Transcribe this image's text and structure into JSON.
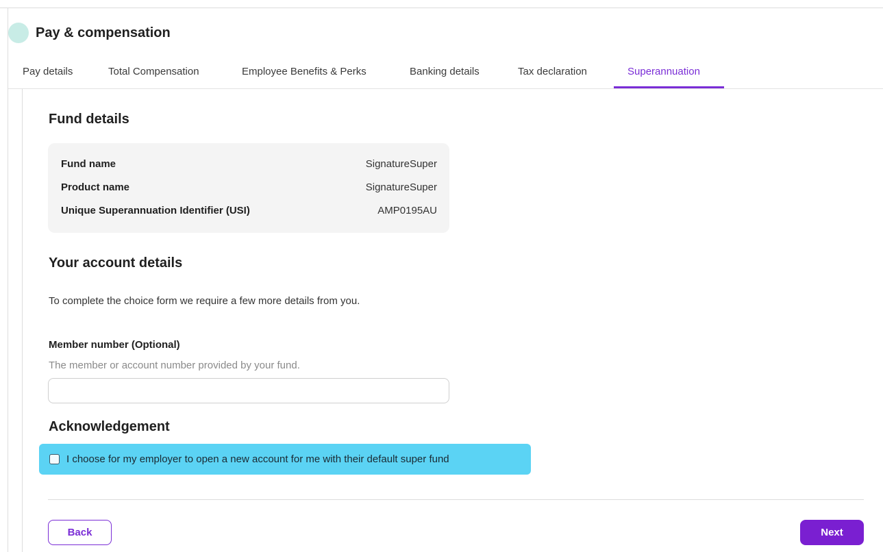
{
  "header": {
    "title": "Pay & compensation"
  },
  "tabs": [
    {
      "label": "Pay details"
    },
    {
      "label": "Total Compensation"
    },
    {
      "label": "Employee Benefits & Perks"
    },
    {
      "label": "Banking details"
    },
    {
      "label": "Tax declaration"
    },
    {
      "label": "Superannuation",
      "active": true
    }
  ],
  "fund": {
    "heading": "Fund details",
    "rows": [
      {
        "label": "Fund name",
        "value": "SignatureSuper"
      },
      {
        "label": "Product name",
        "value": "SignatureSuper"
      },
      {
        "label": "Unique Superannuation Identifier (USI)",
        "value": "AMP0195AU"
      }
    ]
  },
  "account": {
    "heading": "Your account details",
    "description": "To complete the choice form we require a few more details from you.",
    "member_label": "Member number (Optional)",
    "member_help": "The member or account number provided by your fund.",
    "member_value": ""
  },
  "acknowledgement": {
    "heading": "Acknowledgement",
    "checkbox_label": "I choose for my employer to open a new account for me with their default super fund",
    "checked": false
  },
  "footer": {
    "back_label": "Back",
    "next_label": "Next"
  },
  "colors": {
    "accent": "#7a2dd6",
    "highlight": "#5bd3f4",
    "avatar": "#c8ece6"
  }
}
